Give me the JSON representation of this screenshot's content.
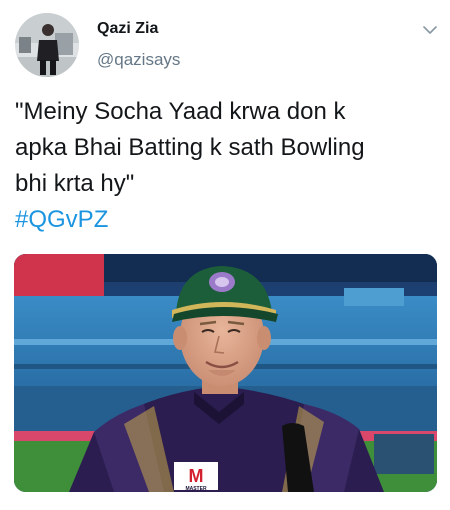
{
  "tweet": {
    "author": {
      "display_name": "Qazi Zia",
      "handle": "@qazisays",
      "avatar_icon": "profile-photo"
    },
    "menu_icon": "chevron-down-icon",
    "text": "\"Meiny Socha Yaad krwa don k\napka Bhai Batting k sath Bowling\nbhi krta hy\"",
    "hashtag": "#QGvPZ",
    "media": {
      "kind": "photo",
      "jersey_logo_text": "M",
      "sponsor_text": "MASTER"
    }
  },
  "colors": {
    "text_primary": "#14171a",
    "text_secondary": "#657786",
    "link": "#1b95e0",
    "stadium_seats": "#2f7fb9",
    "pitch_green": "#3f8f3a",
    "cap_green": "#1d5e3a",
    "jersey_purple": "#2b1d4f"
  }
}
